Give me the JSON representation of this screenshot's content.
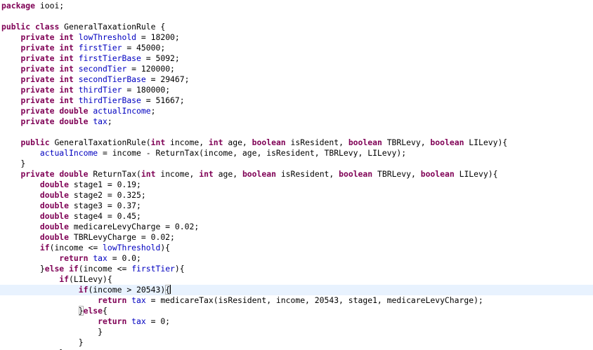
{
  "editor": {
    "lines": [
      [
        {
          "t": "package",
          "k": "kw"
        },
        {
          "t": " iooi;"
        }
      ],
      [],
      [
        {
          "t": "public",
          "k": "kw"
        },
        {
          "t": " "
        },
        {
          "t": "class",
          "k": "kw"
        },
        {
          "t": " GeneralTaxationRule {"
        }
      ],
      [
        {
          "t": "    "
        },
        {
          "t": "private",
          "k": "kw"
        },
        {
          "t": " "
        },
        {
          "t": "int",
          "k": "kw"
        },
        {
          "t": " "
        },
        {
          "t": "lowThreshold",
          "k": "fld"
        },
        {
          "t": " = 18200;"
        }
      ],
      [
        {
          "t": "    "
        },
        {
          "t": "private",
          "k": "kw"
        },
        {
          "t": " "
        },
        {
          "t": "int",
          "k": "kw"
        },
        {
          "t": " "
        },
        {
          "t": "firstTier",
          "k": "fld"
        },
        {
          "t": " = 45000;"
        }
      ],
      [
        {
          "t": "    "
        },
        {
          "t": "private",
          "k": "kw"
        },
        {
          "t": " "
        },
        {
          "t": "int",
          "k": "kw"
        },
        {
          "t": " "
        },
        {
          "t": "firstTierBase",
          "k": "fld"
        },
        {
          "t": " = 5092;"
        }
      ],
      [
        {
          "t": "    "
        },
        {
          "t": "private",
          "k": "kw"
        },
        {
          "t": " "
        },
        {
          "t": "int",
          "k": "kw"
        },
        {
          "t": " "
        },
        {
          "t": "secondTier",
          "k": "fld"
        },
        {
          "t": " = 120000;"
        }
      ],
      [
        {
          "t": "    "
        },
        {
          "t": "private",
          "k": "kw"
        },
        {
          "t": " "
        },
        {
          "t": "int",
          "k": "kw"
        },
        {
          "t": " "
        },
        {
          "t": "secondTierBase",
          "k": "fld"
        },
        {
          "t": " = 29467;"
        }
      ],
      [
        {
          "t": "    "
        },
        {
          "t": "private",
          "k": "kw"
        },
        {
          "t": " "
        },
        {
          "t": "int",
          "k": "kw"
        },
        {
          "t": " "
        },
        {
          "t": "thirdTier",
          "k": "fld"
        },
        {
          "t": " = 180000;"
        }
      ],
      [
        {
          "t": "    "
        },
        {
          "t": "private",
          "k": "kw"
        },
        {
          "t": " "
        },
        {
          "t": "int",
          "k": "kw"
        },
        {
          "t": " "
        },
        {
          "t": "thirdTierBase",
          "k": "fld"
        },
        {
          "t": " = 51667;"
        }
      ],
      [
        {
          "t": "    "
        },
        {
          "t": "private",
          "k": "kw"
        },
        {
          "t": " "
        },
        {
          "t": "double",
          "k": "kw"
        },
        {
          "t": " "
        },
        {
          "t": "actualIncome",
          "k": "fld"
        },
        {
          "t": ";"
        }
      ],
      [
        {
          "t": "    "
        },
        {
          "t": "private",
          "k": "kw"
        },
        {
          "t": " "
        },
        {
          "t": "double",
          "k": "kw"
        },
        {
          "t": " "
        },
        {
          "t": "tax",
          "k": "fld"
        },
        {
          "t": ";"
        }
      ],
      [],
      [
        {
          "t": "    "
        },
        {
          "t": "public",
          "k": "kw"
        },
        {
          "t": " GeneralTaxationRule("
        },
        {
          "t": "int",
          "k": "kw"
        },
        {
          "t": " income, "
        },
        {
          "t": "int",
          "k": "kw"
        },
        {
          "t": " age, "
        },
        {
          "t": "boolean",
          "k": "kw"
        },
        {
          "t": " isResident, "
        },
        {
          "t": "boolean",
          "k": "kw"
        },
        {
          "t": " TBRLevy, "
        },
        {
          "t": "boolean",
          "k": "kw"
        },
        {
          "t": " LILevy){"
        }
      ],
      [
        {
          "t": "        "
        },
        {
          "t": "actualIncome",
          "k": "fld"
        },
        {
          "t": " = income - ReturnTax(income, age, isResident, TBRLevy, LILevy);"
        }
      ],
      [
        {
          "t": "    }"
        }
      ],
      [
        {
          "t": "    "
        },
        {
          "t": "private",
          "k": "kw"
        },
        {
          "t": " "
        },
        {
          "t": "double",
          "k": "kw"
        },
        {
          "t": " ReturnTax("
        },
        {
          "t": "int",
          "k": "kw"
        },
        {
          "t": " income, "
        },
        {
          "t": "int",
          "k": "kw"
        },
        {
          "t": " age, "
        },
        {
          "t": "boolean",
          "k": "kw"
        },
        {
          "t": " isResident, "
        },
        {
          "t": "boolean",
          "k": "kw"
        },
        {
          "t": " TBRLevy, "
        },
        {
          "t": "boolean",
          "k": "kw"
        },
        {
          "t": " LILevy){"
        }
      ],
      [
        {
          "t": "        "
        },
        {
          "t": "double",
          "k": "kw"
        },
        {
          "t": " stage1 = 0.19;"
        }
      ],
      [
        {
          "t": "        "
        },
        {
          "t": "double",
          "k": "kw"
        },
        {
          "t": " stage2 = 0.325;"
        }
      ],
      [
        {
          "t": "        "
        },
        {
          "t": "double",
          "k": "kw"
        },
        {
          "t": " stage3 = 0.37;"
        }
      ],
      [
        {
          "t": "        "
        },
        {
          "t": "double",
          "k": "kw"
        },
        {
          "t": " stage4 = 0.45;"
        }
      ],
      [
        {
          "t": "        "
        },
        {
          "t": "double",
          "k": "kw"
        },
        {
          "t": " medicareLevyCharge = 0.02;"
        }
      ],
      [
        {
          "t": "        "
        },
        {
          "t": "double",
          "k": "kw"
        },
        {
          "t": " TBRLevyCharge = 0.02;"
        }
      ],
      [
        {
          "t": "        "
        },
        {
          "t": "if",
          "k": "kw"
        },
        {
          "t": "(income <= "
        },
        {
          "t": "lowThreshold",
          "k": "fld"
        },
        {
          "t": "){"
        }
      ],
      [
        {
          "t": "            "
        },
        {
          "t": "return",
          "k": "kw"
        },
        {
          "t": " "
        },
        {
          "t": "tax",
          "k": "fld"
        },
        {
          "t": " = 0.0;"
        }
      ],
      [
        {
          "t": "        }"
        },
        {
          "t": "else",
          "k": "kw"
        },
        {
          "t": " "
        },
        {
          "t": "if",
          "k": "kw"
        },
        {
          "t": "(income <= "
        },
        {
          "t": "firstTier",
          "k": "fld"
        },
        {
          "t": "){"
        }
      ],
      [
        {
          "t": "            "
        },
        {
          "t": "if",
          "k": "kw"
        },
        {
          "t": "(LILevy){"
        }
      ],
      [
        {
          "t": "                "
        },
        {
          "t": "if",
          "k": "kw"
        },
        {
          "t": "(income > 20543)"
        },
        {
          "t": "{",
          "k": "box"
        },
        {
          "t": "",
          "k": "cursor"
        }
      ],
      [
        {
          "t": "                    "
        },
        {
          "t": "return",
          "k": "kw"
        },
        {
          "t": " "
        },
        {
          "t": "tax",
          "k": "fld"
        },
        {
          "t": " = medicareTax(isResident, income, 20543, stage1, medicareLevyCharge);"
        }
      ],
      [
        {
          "t": "                "
        },
        {
          "t": "}",
          "k": "box"
        },
        {
          "t": "else",
          "k": "kw"
        },
        {
          "t": "{"
        }
      ],
      [
        {
          "t": "                    "
        },
        {
          "t": "return",
          "k": "kw"
        },
        {
          "t": " "
        },
        {
          "t": "tax",
          "k": "fld"
        },
        {
          "t": " = 0;"
        }
      ],
      [
        {
          "t": "                    }"
        }
      ],
      [
        {
          "t": "                }"
        }
      ],
      [
        {
          "t": "            "
        },
        {
          "t": "}",
          "k": "partial"
        }
      ]
    ],
    "current_line_index": 27,
    "colors": {
      "keyword": "#7f0055",
      "field": "#0000c0",
      "text": "#000000",
      "current_line_bg": "#e8f2fe",
      "bracket_outline": "#b0b0b0"
    }
  }
}
